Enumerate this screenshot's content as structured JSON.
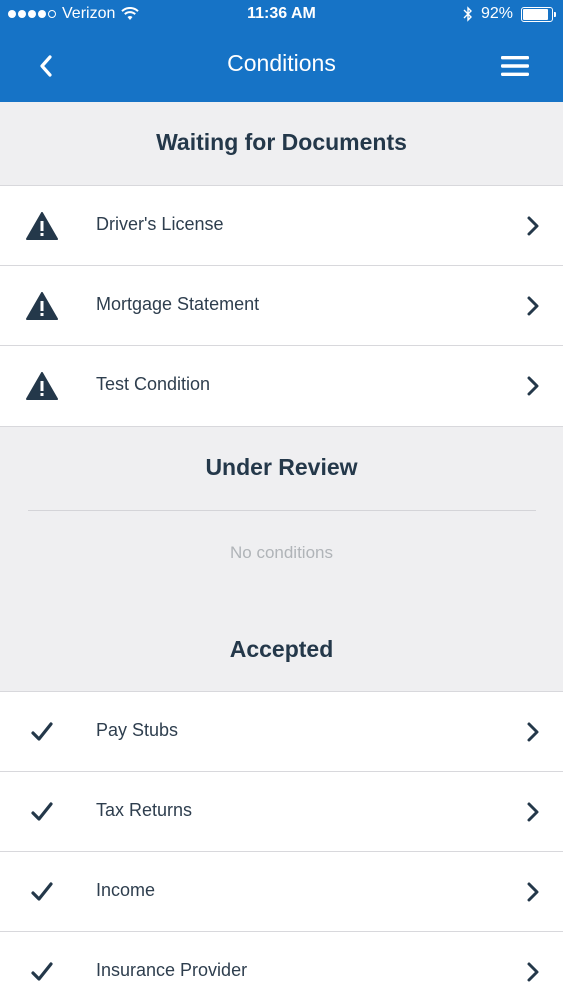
{
  "status_bar": {
    "carrier": "Verizon",
    "time": "11:36 AM",
    "battery_percent": "92%",
    "battery_level": 0.92
  },
  "nav": {
    "title": "Conditions",
    "back_icon": "chevron-left-icon",
    "menu_icon": "hamburger-menu-icon"
  },
  "sections": {
    "waiting": {
      "title": "Waiting for Documents",
      "items": [
        {
          "label": "Driver's License",
          "icon": "warning-icon"
        },
        {
          "label": "Mortgage Statement",
          "icon": "warning-icon"
        },
        {
          "label": "Test Condition",
          "icon": "warning-icon"
        }
      ]
    },
    "review": {
      "title": "Under Review",
      "empty_text": "No conditions"
    },
    "accepted": {
      "title": "Accepted",
      "items": [
        {
          "label": "Pay Stubs",
          "icon": "checkmark-icon"
        },
        {
          "label": "Tax Returns",
          "icon": "checkmark-icon"
        },
        {
          "label": "Income",
          "icon": "checkmark-icon"
        },
        {
          "label": "Insurance Provider",
          "icon": "checkmark-icon"
        }
      ]
    }
  },
  "colors": {
    "accent": "#1673c6",
    "text_dark": "#24384a",
    "background": "#efeff1"
  }
}
